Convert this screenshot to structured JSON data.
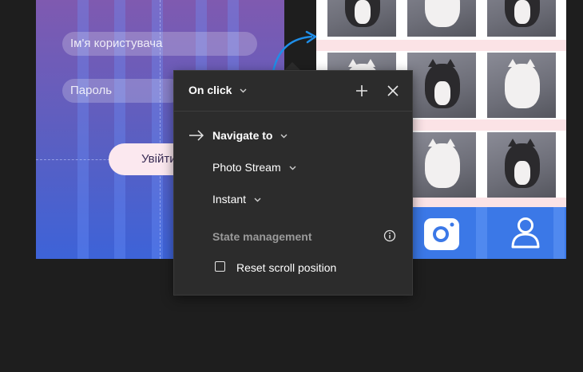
{
  "login_frame": {
    "username_placeholder": "Ім'я користувача",
    "password_placeholder": "Пароль",
    "login_button_label": "Увійти"
  },
  "popover": {
    "trigger": "On click",
    "action": "Navigate to",
    "destination": "Photo Stream",
    "animation": "Instant",
    "state_section": "State management",
    "reset_scroll_label": "Reset scroll position",
    "reset_scroll_checked": false
  },
  "photo_frame": {
    "tab_icons": [
      "camera-icon",
      "user-icon"
    ]
  },
  "colors": {
    "canvas": "#1e1e1e",
    "popover_bg": "#2c2c2c",
    "accent_blue": "#3b78e7",
    "connector": "#1f8ee8",
    "muted_text": "#9a9a9a"
  }
}
